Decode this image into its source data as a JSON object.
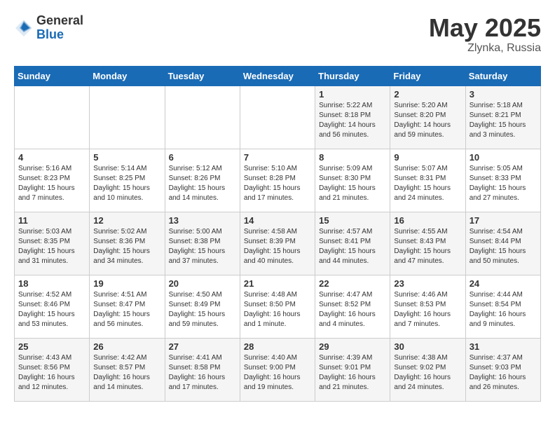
{
  "header": {
    "logo_general": "General",
    "logo_blue": "Blue",
    "month": "May 2025",
    "location": "Zlynka, Russia"
  },
  "days_of_week": [
    "Sunday",
    "Monday",
    "Tuesday",
    "Wednesday",
    "Thursday",
    "Friday",
    "Saturday"
  ],
  "weeks": [
    [
      {
        "day": "",
        "info": ""
      },
      {
        "day": "",
        "info": ""
      },
      {
        "day": "",
        "info": ""
      },
      {
        "day": "",
        "info": ""
      },
      {
        "day": "1",
        "info": "Sunrise: 5:22 AM\nSunset: 8:18 PM\nDaylight: 14 hours\nand 56 minutes."
      },
      {
        "day": "2",
        "info": "Sunrise: 5:20 AM\nSunset: 8:20 PM\nDaylight: 14 hours\nand 59 minutes."
      },
      {
        "day": "3",
        "info": "Sunrise: 5:18 AM\nSunset: 8:21 PM\nDaylight: 15 hours\nand 3 minutes."
      }
    ],
    [
      {
        "day": "4",
        "info": "Sunrise: 5:16 AM\nSunset: 8:23 PM\nDaylight: 15 hours\nand 7 minutes."
      },
      {
        "day": "5",
        "info": "Sunrise: 5:14 AM\nSunset: 8:25 PM\nDaylight: 15 hours\nand 10 minutes."
      },
      {
        "day": "6",
        "info": "Sunrise: 5:12 AM\nSunset: 8:26 PM\nDaylight: 15 hours\nand 14 minutes."
      },
      {
        "day": "7",
        "info": "Sunrise: 5:10 AM\nSunset: 8:28 PM\nDaylight: 15 hours\nand 17 minutes."
      },
      {
        "day": "8",
        "info": "Sunrise: 5:09 AM\nSunset: 8:30 PM\nDaylight: 15 hours\nand 21 minutes."
      },
      {
        "day": "9",
        "info": "Sunrise: 5:07 AM\nSunset: 8:31 PM\nDaylight: 15 hours\nand 24 minutes."
      },
      {
        "day": "10",
        "info": "Sunrise: 5:05 AM\nSunset: 8:33 PM\nDaylight: 15 hours\nand 27 minutes."
      }
    ],
    [
      {
        "day": "11",
        "info": "Sunrise: 5:03 AM\nSunset: 8:35 PM\nDaylight: 15 hours\nand 31 minutes."
      },
      {
        "day": "12",
        "info": "Sunrise: 5:02 AM\nSunset: 8:36 PM\nDaylight: 15 hours\nand 34 minutes."
      },
      {
        "day": "13",
        "info": "Sunrise: 5:00 AM\nSunset: 8:38 PM\nDaylight: 15 hours\nand 37 minutes."
      },
      {
        "day": "14",
        "info": "Sunrise: 4:58 AM\nSunset: 8:39 PM\nDaylight: 15 hours\nand 40 minutes."
      },
      {
        "day": "15",
        "info": "Sunrise: 4:57 AM\nSunset: 8:41 PM\nDaylight: 15 hours\nand 44 minutes."
      },
      {
        "day": "16",
        "info": "Sunrise: 4:55 AM\nSunset: 8:43 PM\nDaylight: 15 hours\nand 47 minutes."
      },
      {
        "day": "17",
        "info": "Sunrise: 4:54 AM\nSunset: 8:44 PM\nDaylight: 15 hours\nand 50 minutes."
      }
    ],
    [
      {
        "day": "18",
        "info": "Sunrise: 4:52 AM\nSunset: 8:46 PM\nDaylight: 15 hours\nand 53 minutes."
      },
      {
        "day": "19",
        "info": "Sunrise: 4:51 AM\nSunset: 8:47 PM\nDaylight: 15 hours\nand 56 minutes."
      },
      {
        "day": "20",
        "info": "Sunrise: 4:50 AM\nSunset: 8:49 PM\nDaylight: 15 hours\nand 59 minutes."
      },
      {
        "day": "21",
        "info": "Sunrise: 4:48 AM\nSunset: 8:50 PM\nDaylight: 16 hours\nand 1 minute."
      },
      {
        "day": "22",
        "info": "Sunrise: 4:47 AM\nSunset: 8:52 PM\nDaylight: 16 hours\nand 4 minutes."
      },
      {
        "day": "23",
        "info": "Sunrise: 4:46 AM\nSunset: 8:53 PM\nDaylight: 16 hours\nand 7 minutes."
      },
      {
        "day": "24",
        "info": "Sunrise: 4:44 AM\nSunset: 8:54 PM\nDaylight: 16 hours\nand 9 minutes."
      }
    ],
    [
      {
        "day": "25",
        "info": "Sunrise: 4:43 AM\nSunset: 8:56 PM\nDaylight: 16 hours\nand 12 minutes."
      },
      {
        "day": "26",
        "info": "Sunrise: 4:42 AM\nSunset: 8:57 PM\nDaylight: 16 hours\nand 14 minutes."
      },
      {
        "day": "27",
        "info": "Sunrise: 4:41 AM\nSunset: 8:58 PM\nDaylight: 16 hours\nand 17 minutes."
      },
      {
        "day": "28",
        "info": "Sunrise: 4:40 AM\nSunset: 9:00 PM\nDaylight: 16 hours\nand 19 minutes."
      },
      {
        "day": "29",
        "info": "Sunrise: 4:39 AM\nSunset: 9:01 PM\nDaylight: 16 hours\nand 21 minutes."
      },
      {
        "day": "30",
        "info": "Sunrise: 4:38 AM\nSunset: 9:02 PM\nDaylight: 16 hours\nand 24 minutes."
      },
      {
        "day": "31",
        "info": "Sunrise: 4:37 AM\nSunset: 9:03 PM\nDaylight: 16 hours\nand 26 minutes."
      }
    ]
  ]
}
